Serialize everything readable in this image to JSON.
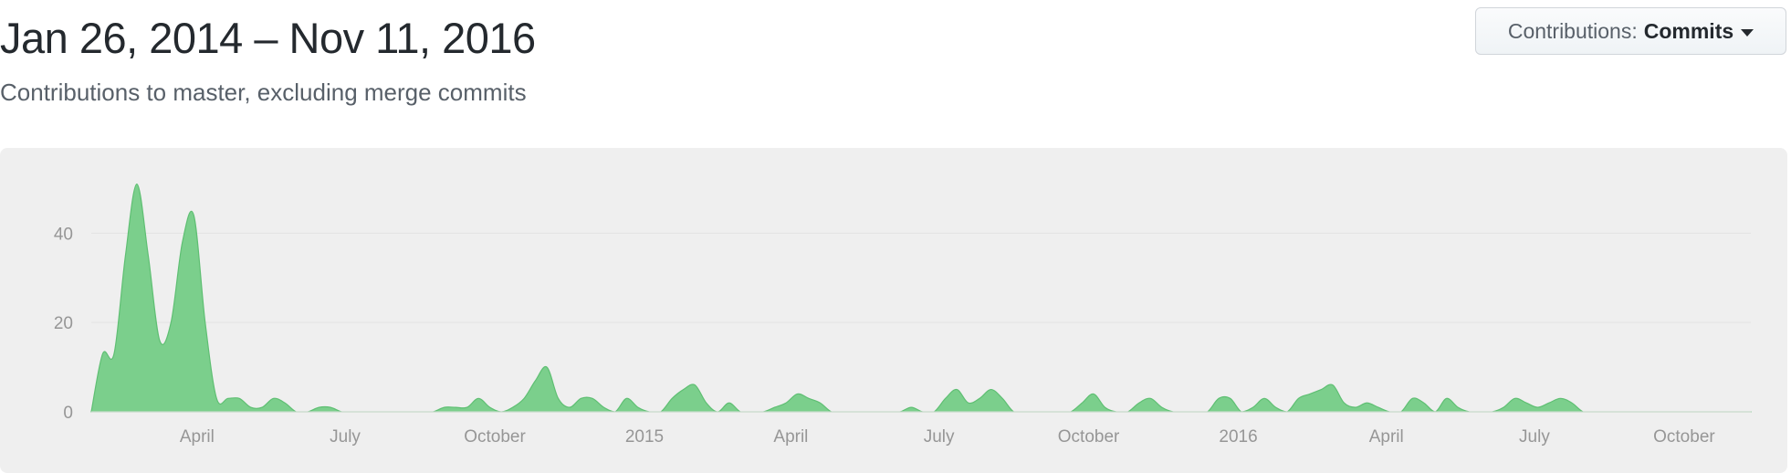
{
  "header": {
    "date_range": "Jan 26, 2014 – Nov 11, 2016",
    "subtitle": "Contributions to master, excluding merge commits"
  },
  "contributions_button": {
    "label": "Contributions:",
    "value": "Commits",
    "caret_icon": "caret-down-icon"
  },
  "colors": {
    "area_fill": "#7bcf8c",
    "area_stroke": "#5fbf73",
    "panel_bg": "#efefef",
    "grid": "#e3e3e3",
    "tick_text": "#969696"
  },
  "chart_data": {
    "type": "area",
    "title": "",
    "xlabel": "",
    "ylabel": "",
    "ylim": [
      0,
      55
    ],
    "xlim": [
      "2014-01-26",
      "2016-11-11"
    ],
    "grid": true,
    "y_ticks": [
      0,
      20,
      40
    ],
    "x_ticks": [
      {
        "date": "2014-04-01",
        "label": "April"
      },
      {
        "date": "2014-07-01",
        "label": "July"
      },
      {
        "date": "2014-10-01",
        "label": "October"
      },
      {
        "date": "2015-01-01",
        "label": "2015"
      },
      {
        "date": "2015-04-01",
        "label": "April"
      },
      {
        "date": "2015-07-01",
        "label": "July"
      },
      {
        "date": "2015-10-01",
        "label": "October"
      },
      {
        "date": "2016-01-01",
        "label": "2016"
      },
      {
        "date": "2016-04-01",
        "label": "April"
      },
      {
        "date": "2016-07-01",
        "label": "July"
      },
      {
        "date": "2016-10-01",
        "label": "October"
      }
    ],
    "x": [
      "2014-01-26",
      "2014-02-02",
      "2014-02-09",
      "2014-02-16",
      "2014-02-23",
      "2014-03-02",
      "2014-03-09",
      "2014-03-16",
      "2014-03-23",
      "2014-03-30",
      "2014-04-06",
      "2014-04-13",
      "2014-04-20",
      "2014-04-27",
      "2014-05-04",
      "2014-05-11",
      "2014-05-18",
      "2014-05-25",
      "2014-06-01",
      "2014-06-08",
      "2014-06-15",
      "2014-06-22",
      "2014-06-29",
      "2014-07-06",
      "2014-07-13",
      "2014-07-20",
      "2014-07-27",
      "2014-08-03",
      "2014-08-10",
      "2014-08-17",
      "2014-08-24",
      "2014-08-31",
      "2014-09-07",
      "2014-09-14",
      "2014-09-21",
      "2014-09-28",
      "2014-10-05",
      "2014-10-12",
      "2014-10-19",
      "2014-10-26",
      "2014-11-02",
      "2014-11-09",
      "2014-11-16",
      "2014-11-23",
      "2014-11-30",
      "2014-12-07",
      "2014-12-14",
      "2014-12-21",
      "2014-12-28",
      "2015-01-04",
      "2015-01-11",
      "2015-01-18",
      "2015-01-25",
      "2015-02-01",
      "2015-02-08",
      "2015-02-15",
      "2015-02-22",
      "2015-03-01",
      "2015-03-08",
      "2015-03-15",
      "2015-03-22",
      "2015-03-29",
      "2015-04-05",
      "2015-04-12",
      "2015-04-19",
      "2015-04-26",
      "2015-05-03",
      "2015-05-10",
      "2015-05-17",
      "2015-05-24",
      "2015-05-31",
      "2015-06-07",
      "2015-06-14",
      "2015-06-21",
      "2015-06-28",
      "2015-07-05",
      "2015-07-12",
      "2015-07-19",
      "2015-07-26",
      "2015-08-02",
      "2015-08-09",
      "2015-08-16",
      "2015-08-23",
      "2015-08-30",
      "2015-09-06",
      "2015-09-13",
      "2015-09-20",
      "2015-09-27",
      "2015-10-04",
      "2015-10-11",
      "2015-10-18",
      "2015-10-25",
      "2015-11-01",
      "2015-11-08",
      "2015-11-15",
      "2015-11-22",
      "2015-11-29",
      "2015-12-06",
      "2015-12-13",
      "2015-12-20",
      "2015-12-27",
      "2016-01-03",
      "2016-01-10",
      "2016-01-17",
      "2016-01-24",
      "2016-01-31",
      "2016-02-07",
      "2016-02-14",
      "2016-02-21",
      "2016-02-28",
      "2016-03-06",
      "2016-03-13",
      "2016-03-20",
      "2016-03-27",
      "2016-04-03",
      "2016-04-10",
      "2016-04-17",
      "2016-04-24",
      "2016-05-01",
      "2016-05-08",
      "2016-05-15",
      "2016-05-22",
      "2016-05-29",
      "2016-06-05",
      "2016-06-12",
      "2016-06-19",
      "2016-06-26",
      "2016-07-03",
      "2016-07-10",
      "2016-07-17",
      "2016-07-24",
      "2016-07-31",
      "2016-08-07",
      "2016-08-14",
      "2016-08-21",
      "2016-08-28",
      "2016-09-04",
      "2016-09-11",
      "2016-09-18",
      "2016-09-25",
      "2016-10-02",
      "2016-10-09",
      "2016-10-16",
      "2016-10-23",
      "2016-10-30",
      "2016-11-06"
    ],
    "series": [
      {
        "values": [
          0,
          13,
          13,
          35,
          51,
          35,
          16,
          20,
          38,
          44,
          20,
          3,
          3,
          3,
          1,
          1,
          3,
          2,
          0,
          0,
          1,
          1,
          0,
          0,
          0,
          0,
          0,
          0,
          0,
          0,
          0,
          1,
          1,
          1,
          3,
          1,
          0,
          1,
          3,
          7,
          10,
          3,
          1,
          3,
          3,
          1,
          0,
          3,
          1,
          0,
          0,
          3,
          5,
          6,
          2,
          0,
          2,
          0,
          0,
          0,
          1,
          2,
          4,
          3,
          2,
          0,
          0,
          0,
          0,
          0,
          0,
          0,
          1,
          0,
          0,
          3,
          5,
          2,
          3,
          5,
          3,
          0,
          0,
          0,
          0,
          0,
          0,
          2,
          4,
          1,
          0,
          0,
          2,
          3,
          1,
          0,
          0,
          0,
          0,
          3,
          3,
          0,
          1,
          3,
          1,
          0,
          3,
          4,
          5,
          6,
          2,
          1,
          2,
          1,
          0,
          0,
          3,
          2,
          0,
          3,
          1,
          0,
          0,
          0,
          1,
          3,
          2,
          1,
          2,
          3,
          2,
          0,
          0,
          0,
          0,
          0,
          0,
          0,
          0,
          0,
          0,
          0,
          0,
          0,
          0,
          0
        ]
      }
    ]
  }
}
